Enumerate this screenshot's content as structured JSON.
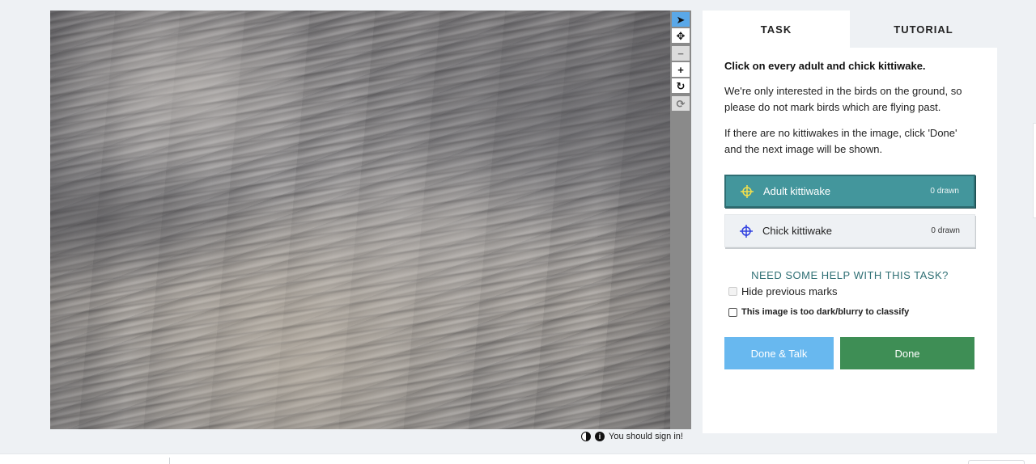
{
  "viewer": {
    "signin_note": "You should sign in!",
    "tools": [
      {
        "icon": "pointer-icon",
        "glyph": "➤",
        "state": "active"
      },
      {
        "icon": "move-icon",
        "glyph": "✥",
        "state": "normal"
      },
      {
        "icon": "zoom-out-icon",
        "glyph": "−",
        "state": "disabled"
      },
      {
        "icon": "zoom-in-icon",
        "glyph": "+",
        "state": "normal"
      },
      {
        "icon": "rotate-icon",
        "glyph": "↻",
        "state": "normal"
      },
      {
        "icon": "reset-icon",
        "glyph": "⟳",
        "state": "disabled"
      }
    ]
  },
  "panel": {
    "tabs": [
      {
        "label": "TASK",
        "active": true
      },
      {
        "label": "TUTORIAL",
        "active": false
      }
    ],
    "instructions": {
      "title": "Click on every adult and chick kittiwake.",
      "paragraphs": [
        "We're only interested in the birds on the ground, so please do not mark birds which are flying past.",
        "If there are no kittiwakes in the image, click 'Done' and the next image will be shown."
      ]
    },
    "tool_options": [
      {
        "label": "Adult kittiwake",
        "count": "0 drawn",
        "selected": true,
        "color": "#f4e04d"
      },
      {
        "label": "Chick kittiwake",
        "count": "0 drawn",
        "selected": false,
        "color": "#2f3fe0"
      }
    ],
    "help_link": "NEED SOME HELP WITH THIS TASK?",
    "hide_marks_label": "Hide previous marks",
    "dark_blurry_label": "This image is too dark/blurry to classify",
    "done_talk_label": "Done & Talk",
    "done_label": "Done"
  },
  "colors": {
    "accent_teal": "#43969c",
    "done_green": "#3e8e55",
    "done_talk_blue": "#68b8ef",
    "active_tool_blue": "#5aa8e8"
  }
}
